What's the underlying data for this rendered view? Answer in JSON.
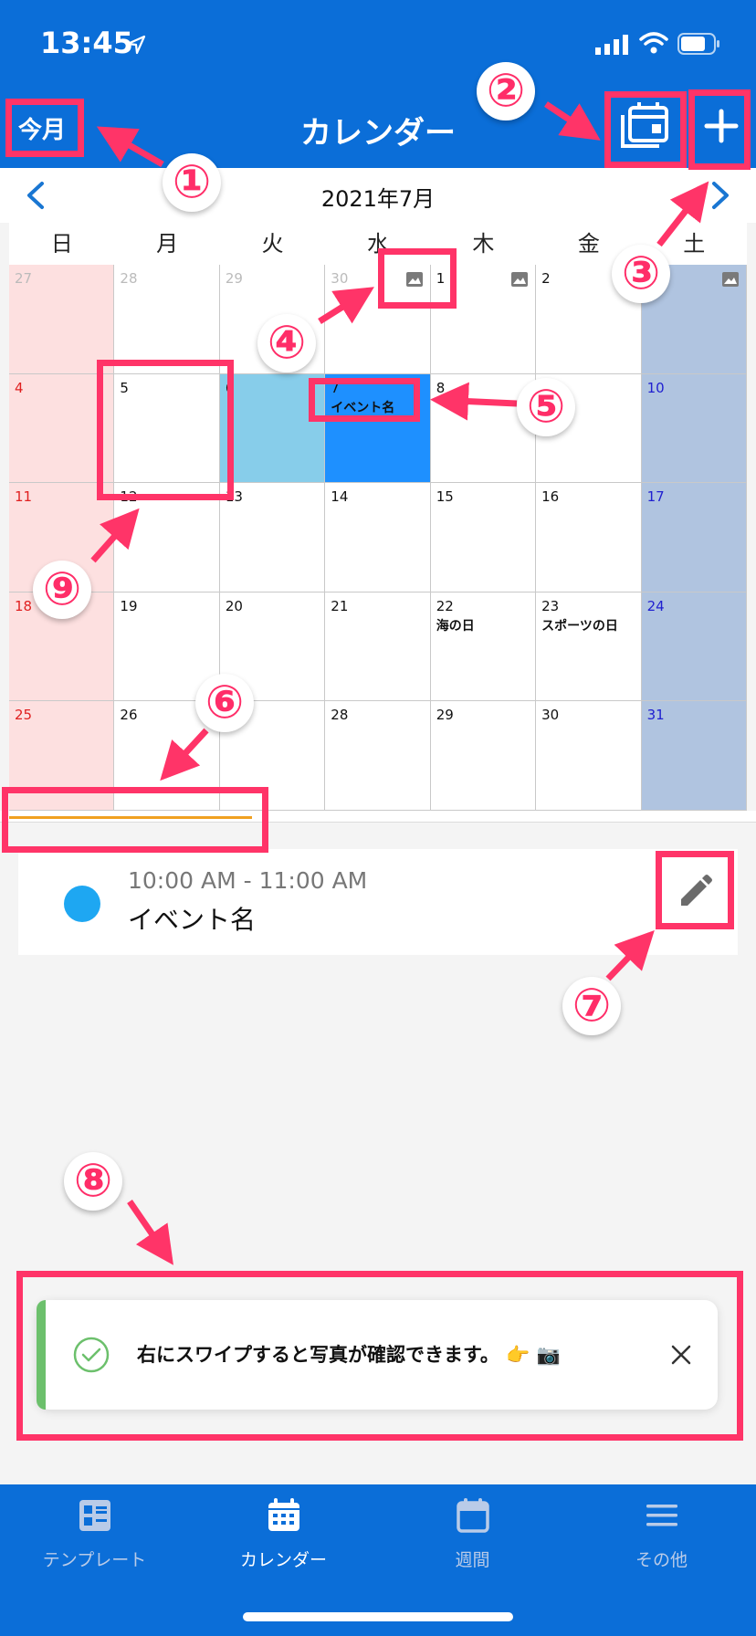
{
  "status_bar": {
    "time": "13:45"
  },
  "header": {
    "title": "カレンダー",
    "today_label": "今月"
  },
  "month_bar": {
    "label": "2021年7月"
  },
  "weekdays": [
    "日",
    "月",
    "火",
    "水",
    "木",
    "金",
    "土"
  ],
  "calendar": {
    "rows": [
      [
        {
          "d": "27"
        },
        {
          "d": "28"
        },
        {
          "d": "29"
        },
        {
          "d": "30"
        },
        {
          "d": "1"
        },
        {
          "d": "2"
        },
        {
          "d": ""
        }
      ],
      [
        {
          "d": "4"
        },
        {
          "d": "5"
        },
        {
          "d": "6"
        },
        {
          "d": "7",
          "ev": "イベント名"
        },
        {
          "d": "8"
        },
        {
          "d": ""
        },
        {
          "d": "10"
        }
      ],
      [
        {
          "d": "11"
        },
        {
          "d": "12"
        },
        {
          "d": "13"
        },
        {
          "d": "14"
        },
        {
          "d": "15"
        },
        {
          "d": "16"
        },
        {
          "d": "17"
        }
      ],
      [
        {
          "d": "18"
        },
        {
          "d": "19"
        },
        {
          "d": "20"
        },
        {
          "d": "21"
        },
        {
          "d": "22",
          "ev": "海の日"
        },
        {
          "d": "23",
          "ev": "スポーツの日"
        },
        {
          "d": "24"
        }
      ],
      [
        {
          "d": "25"
        },
        {
          "d": "26"
        },
        {
          "d": ""
        },
        {
          "d": "28"
        },
        {
          "d": "29"
        },
        {
          "d": "30"
        },
        {
          "d": "31"
        }
      ]
    ],
    "colors": {
      "sunday_bg": "#fde0e0",
      "saturday_bg": "#b0c4e0",
      "selected_bg": "#1e90ff",
      "today_bg": "#87cdea",
      "sunday_text": "#e02020",
      "saturday_text": "#2020d0",
      "muted_text": "#bbbbbb"
    }
  },
  "event": {
    "time": "10:00 AM - 11:00 AM",
    "name": "イベント名",
    "dot_color": "#1ea7f2"
  },
  "toast": {
    "message": "右にスワイプすると写真が確認できます。 👉 📷",
    "accent": "#6cc06c"
  },
  "tabs": [
    {
      "label": "テンプレート",
      "icon": "template-icon"
    },
    {
      "label": "カレンダー",
      "icon": "calendar-icon",
      "active": true
    },
    {
      "label": "週間",
      "icon": "week-icon"
    },
    {
      "label": "その他",
      "icon": "menu-icon"
    }
  ],
  "annotations": {
    "b1": "①",
    "b2": "②",
    "b3": "③",
    "b4": "④",
    "b5": "⑤",
    "b6": "⑥",
    "b7": "⑦",
    "b8": "⑧",
    "b9": "⑨"
  }
}
